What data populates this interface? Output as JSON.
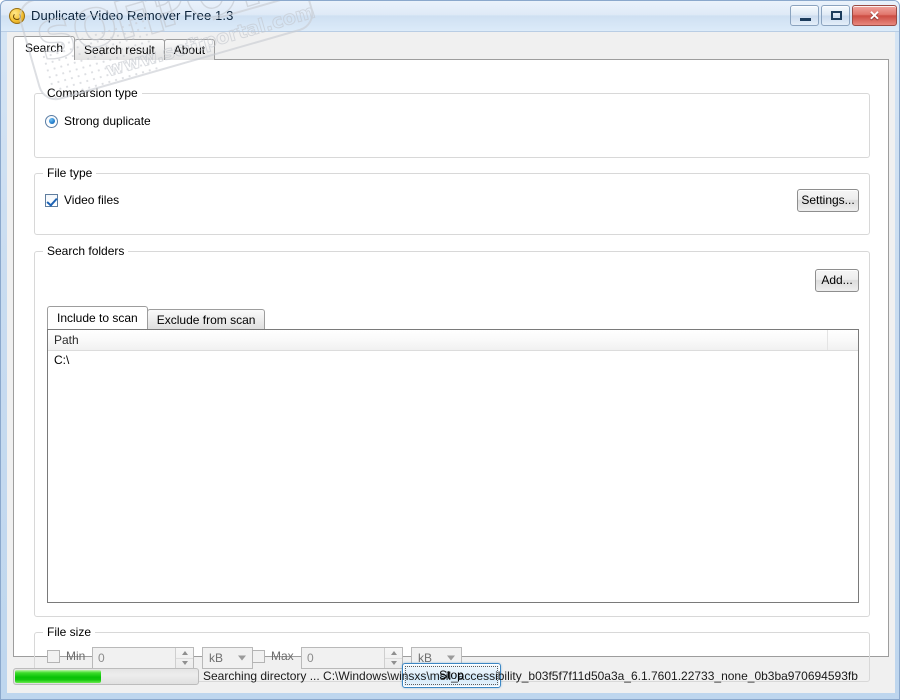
{
  "window": {
    "title": "Duplicate Video Remover Free 1.3",
    "icon": "app-circle-icon",
    "controls": {
      "minimize": "minimize-icon",
      "maximize": "maximize-icon",
      "close": "✕"
    }
  },
  "tabs": [
    {
      "label": "Search",
      "active": true
    },
    {
      "label": "Search result",
      "active": false
    },
    {
      "label": "About",
      "active": false
    }
  ],
  "comparison": {
    "legend": "Comparsion type",
    "options": [
      {
        "label": "Strong duplicate",
        "checked": true
      }
    ]
  },
  "file_type": {
    "legend": "File type",
    "options": [
      {
        "label": "Video files",
        "checked": true
      }
    ],
    "settings_button": "Settings..."
  },
  "search_folders": {
    "legend": "Search folders",
    "add_button": "Add...",
    "inner_tabs": [
      {
        "label": "Include to scan",
        "active": true
      },
      {
        "label": "Exclude from scan",
        "active": false
      }
    ],
    "columns": [
      "Path",
      ""
    ],
    "rows": [
      {
        "path": "C:\\"
      }
    ]
  },
  "file_size": {
    "legend": "File size",
    "min": {
      "checkbox_label": "Min",
      "checked": false,
      "value": "0",
      "unit": "kB"
    },
    "max": {
      "checkbox_label": "Max",
      "checked": false,
      "value": "0",
      "unit": "kB"
    }
  },
  "action": {
    "stop_button": "Stop"
  },
  "statusbar": {
    "progress_percent": 47,
    "text": "Searching directory ... C:\\Windows\\winsxs\\msil_accessibility_b03f5f7f11d50a3a_6.1.7601.22733_none_0b3ba970694593fb"
  },
  "watermark": {
    "word1": "SOFT",
    "word2": "PORTAL",
    "tm": "TM",
    "url": "www.softportal.com"
  },
  "colors": {
    "progress_green": "#09c207",
    "accent_blue": "#1a74c4",
    "close_red": "#cc4d43"
  }
}
